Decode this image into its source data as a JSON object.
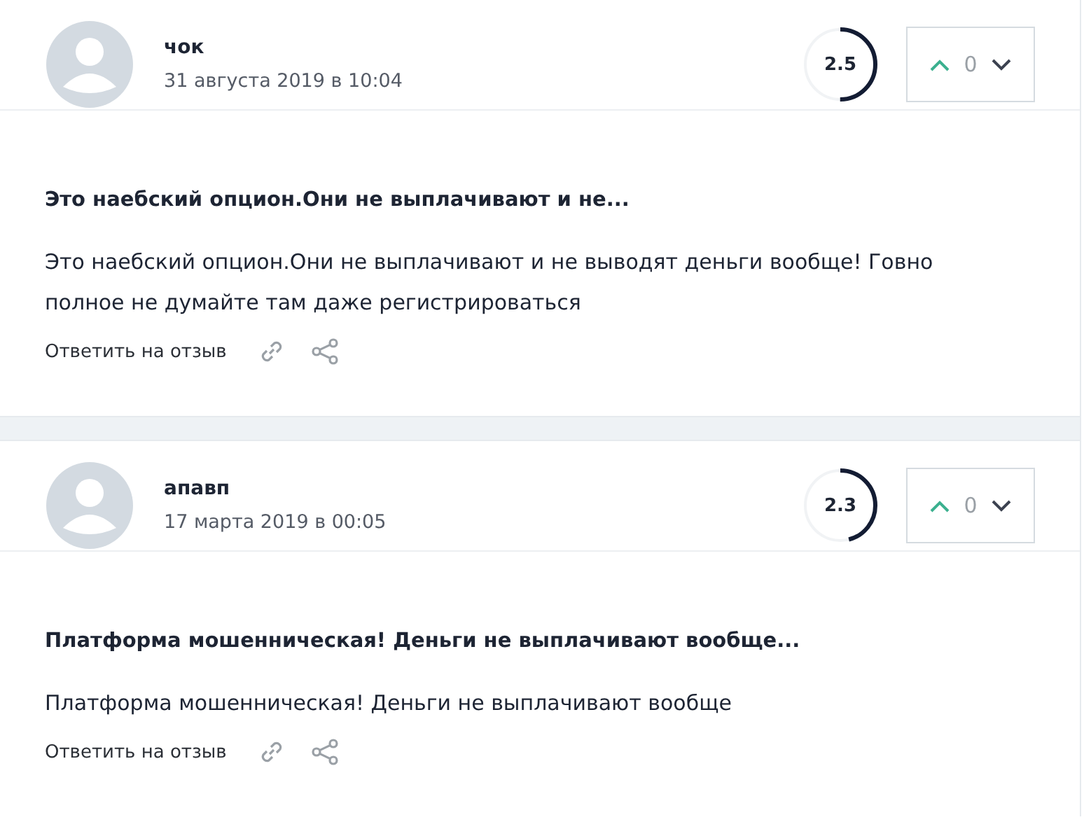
{
  "reviews": [
    {
      "author": "чок",
      "date": "31 августа 2019 в 10:04",
      "rating": {
        "value": "2.5",
        "level": 0.5
      },
      "votes": {
        "count": "0"
      },
      "title": "Это наебский опцион.Они не выплачивают и не...",
      "text": "Это наебский опцион.Они не выплачивают и не выводят деньги вообще! Говно полное не думайте там даже регистрироваться",
      "reply": "Ответить на отзыв"
    },
    {
      "author": "апавп",
      "date": "17 марта 2019 в 00:05",
      "rating": {
        "value": "2.3",
        "level": 0.46
      },
      "votes": {
        "count": "0"
      },
      "title": "Платформа мошенническая! Деньги не выплачивают вообще...",
      "text": "Платформа мошенническая! Деньги не выплачивают вообще",
      "reply": "Ответить на отзыв"
    }
  ]
}
